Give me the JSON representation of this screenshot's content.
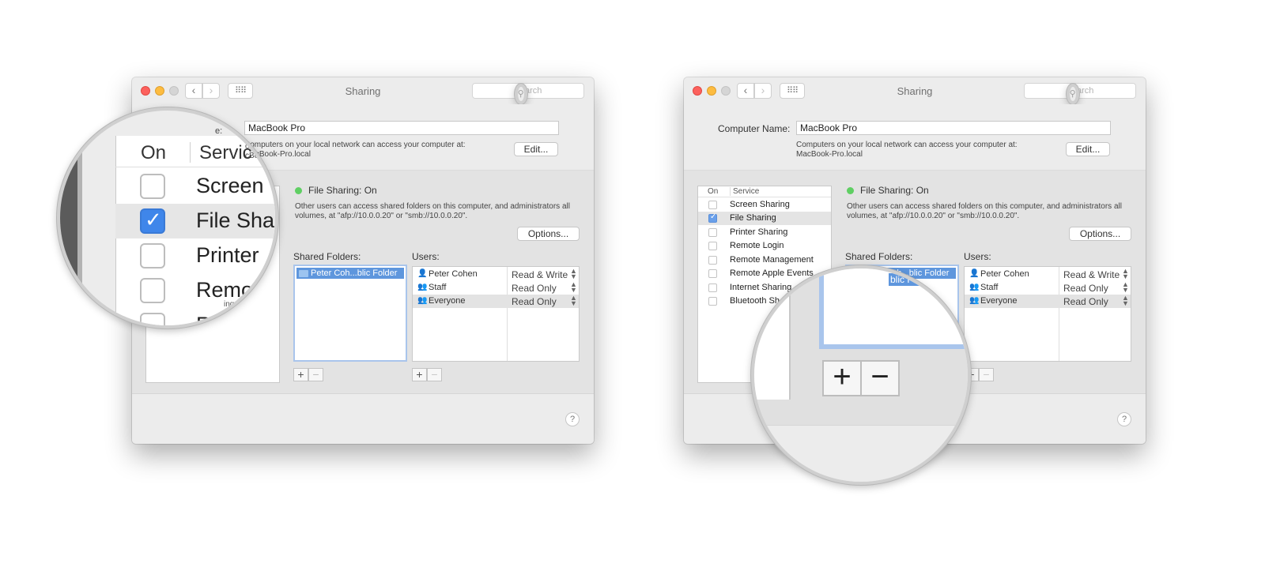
{
  "window": {
    "title": "Sharing",
    "search_placeholder": "Search",
    "nav_back": "‹",
    "nav_forward": "›",
    "grid_glyph": "⠿⠿"
  },
  "computer_name": {
    "label": "Computer Name:",
    "value": "MacBook Pro",
    "description_line1": "Computers on your local network can access your computer at:",
    "description_line2": "MacBook-Pro.local",
    "edit_button": "Edit..."
  },
  "services": {
    "header_on": "On",
    "header_service": "Service",
    "items": [
      {
        "label": "Screen Sharing",
        "checked": false,
        "selected": false
      },
      {
        "label": "File Sharing",
        "checked": true,
        "selected": true
      },
      {
        "label": "Printer Sharing",
        "checked": false,
        "selected": false
      },
      {
        "label": "Remote Login",
        "checked": false,
        "selected": false
      },
      {
        "label": "Remote Management",
        "checked": false,
        "selected": false
      },
      {
        "label": "Remote Apple Events",
        "checked": false,
        "selected": false
      },
      {
        "label": "Internet Sharing",
        "checked": false,
        "selected": false
      },
      {
        "label": "Bluetooth Sh",
        "checked": false,
        "selected": false
      }
    ]
  },
  "file_sharing": {
    "status": "File Sharing: On",
    "status_color": "#5fcf63",
    "description": "Other users can access shared folders on this computer, and administrators all volumes, at \"afp://10.0.0.20\" or \"smb://10.0.0.20\".",
    "options_button": "Options...",
    "shared_folders_label": "Shared Folders:",
    "shared_folder_item": "Peter Coh...blic Folder",
    "users_label": "Users:",
    "users": [
      {
        "name": "Peter Cohen",
        "permission": "Read & Write",
        "icon": "single-user-icon"
      },
      {
        "name": "Staff",
        "permission": "Read Only",
        "icon": "group-icon"
      },
      {
        "name": "Everyone",
        "permission": "Read Only",
        "icon": "everyone-icon"
      }
    ],
    "plus": "+",
    "minus": "−",
    "stepper": "⌃⌄",
    "help": "?"
  },
  "magnifier_left": {
    "header_on": "On",
    "header_service": "Servic",
    "rows": [
      "Screen",
      "File Sha",
      "Printer",
      "Remo",
      "R"
    ],
    "fragment_host": "cBook-Pro.local",
    "fragment_desc": "omputers on your local network can access your computer at:",
    "fragment_bottom": "ing",
    "fragment_name": "e:"
  },
  "magnifier_right": {
    "folder_fragment": "blic Folder",
    "plus": "+",
    "minus": "−"
  },
  "colors": {
    "accent": "#5e96dd",
    "close": "#fc615d",
    "minimize": "#fdbc40"
  }
}
